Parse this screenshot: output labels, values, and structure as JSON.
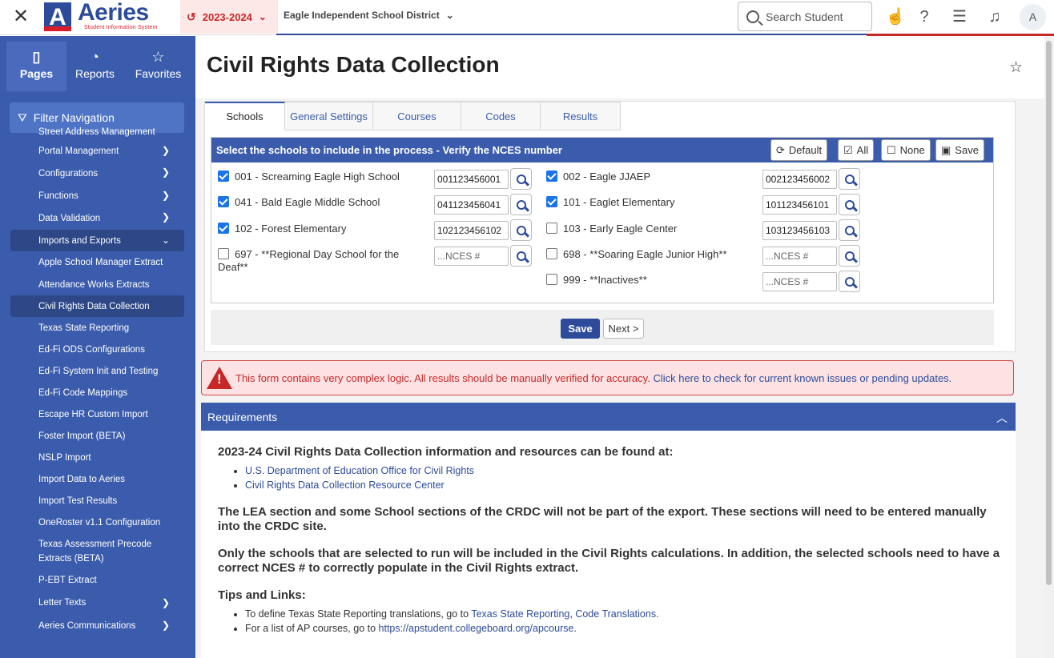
{
  "topbar": {
    "logo_text": "Aeries",
    "logo_sub": "Student Information System",
    "year": "2023-2024",
    "district": "Eagle Independent School District",
    "search_placeholder": "Search Student",
    "avatar": "A"
  },
  "sidebar": {
    "tabs": [
      {
        "label": "Pages",
        "icon": "page-icon"
      },
      {
        "label": "Reports",
        "icon": "chart-icon"
      },
      {
        "label": "Favorites",
        "icon": "star-icon"
      }
    ],
    "filter_label": "Filter Navigation",
    "items": [
      {
        "label": "Street Address Management"
      },
      {
        "label": "Portal Management"
      },
      {
        "label": "Configurations"
      },
      {
        "label": "Functions"
      },
      {
        "label": "Data Validation"
      },
      {
        "label": "Imports and Exports"
      },
      {
        "label": "Apple School Manager Extract"
      },
      {
        "label": "Attendance Works Extracts"
      },
      {
        "label": "Civil Rights Data Collection"
      },
      {
        "label": "Texas State Reporting"
      },
      {
        "label": "Ed-Fi ODS Configurations"
      },
      {
        "label": "Ed-Fi System Init and Testing"
      },
      {
        "label": "Ed-Fi Code Mappings"
      },
      {
        "label": "Escape HR Custom Import"
      },
      {
        "label": "Foster Import (BETA)"
      },
      {
        "label": "NSLP Import"
      },
      {
        "label": "Import Data to Aeries"
      },
      {
        "label": "Import Test Results"
      },
      {
        "label": "OneRoster v1.1 Configuration"
      },
      {
        "label": "Texas Assessment Precode Extracts (BETA)"
      },
      {
        "label": "P-EBT Extract"
      },
      {
        "label": "Letter Texts"
      },
      {
        "label": "Aeries Communications"
      }
    ]
  },
  "page": {
    "title": "Civil Rights Data Collection",
    "tabs": [
      "Schools",
      "General Settings",
      "Courses",
      "Codes",
      "Results"
    ],
    "schools_header": "Select the schools to include in the process - Verify the NCES number",
    "header_buttons": {
      "default": "Default",
      "all": "All",
      "none": "None",
      "save": "Save"
    },
    "schools": [
      {
        "label": "001 - Screaming Eagle High School",
        "checked": true,
        "nces": "001123456001"
      },
      {
        "label": "002 - Eagle JJAEP",
        "checked": true,
        "nces": "002123456002"
      },
      {
        "label": "041 - Bald Eagle Middle School",
        "checked": true,
        "nces": "041123456041"
      },
      {
        "label": "101 - Eaglet Elementary",
        "checked": true,
        "nces": "101123456101"
      },
      {
        "label": "102 - Forest Elementary",
        "checked": true,
        "nces": "102123456102"
      },
      {
        "label": "103 - Early Eagle Center",
        "checked": false,
        "nces": "103123456103"
      },
      {
        "label": "697 - **Regional Day School for the Deaf**",
        "checked": false,
        "nces": ""
      },
      {
        "label": "698 - **Soaring Eagle Junior High**",
        "checked": false,
        "nces": ""
      },
      {
        "label": "999 - **Inactives**",
        "checked": false,
        "nces": ""
      }
    ],
    "nces_placeholder": "...NCES #",
    "save_button": "Save",
    "next_button": "Next >",
    "alert": {
      "text": "This form contains very complex logic. All results should be manually verified for accuracy.",
      "link": "Click here to check for current known issues or pending updates."
    },
    "requirements": {
      "title": "Requirements",
      "intro": "2023-24 Civil Rights Data Collection information and resources can be found at:",
      "links": [
        "U.S. Department of Education Office for Civil Rights",
        "Civil Rights Data Collection Resource Center"
      ],
      "para1": "The LEA section and some School sections of the CRDC will not be part of the export. These sections will need to be entered manually into the CRDC site.",
      "para2": "Only the schools that are selected to run will be included in the Civil Rights calculations. In addition, the selected schools need to have a correct NCES # to correctly populate in the Civil Rights extract.",
      "tips_title": "Tips and Links:",
      "tip1_prefix": "To define Texas State Reporting translations, go to",
      "tip1_link1": "Texas State Reporting",
      "tip1_sep": ",",
      "tip1_link2": "Code Translations.",
      "tip2_prefix": "For a list of AP courses, go to",
      "tip2_link": "https://apstudent.collegeboard.org/apcourse",
      "tip2_suffix": "."
    }
  }
}
